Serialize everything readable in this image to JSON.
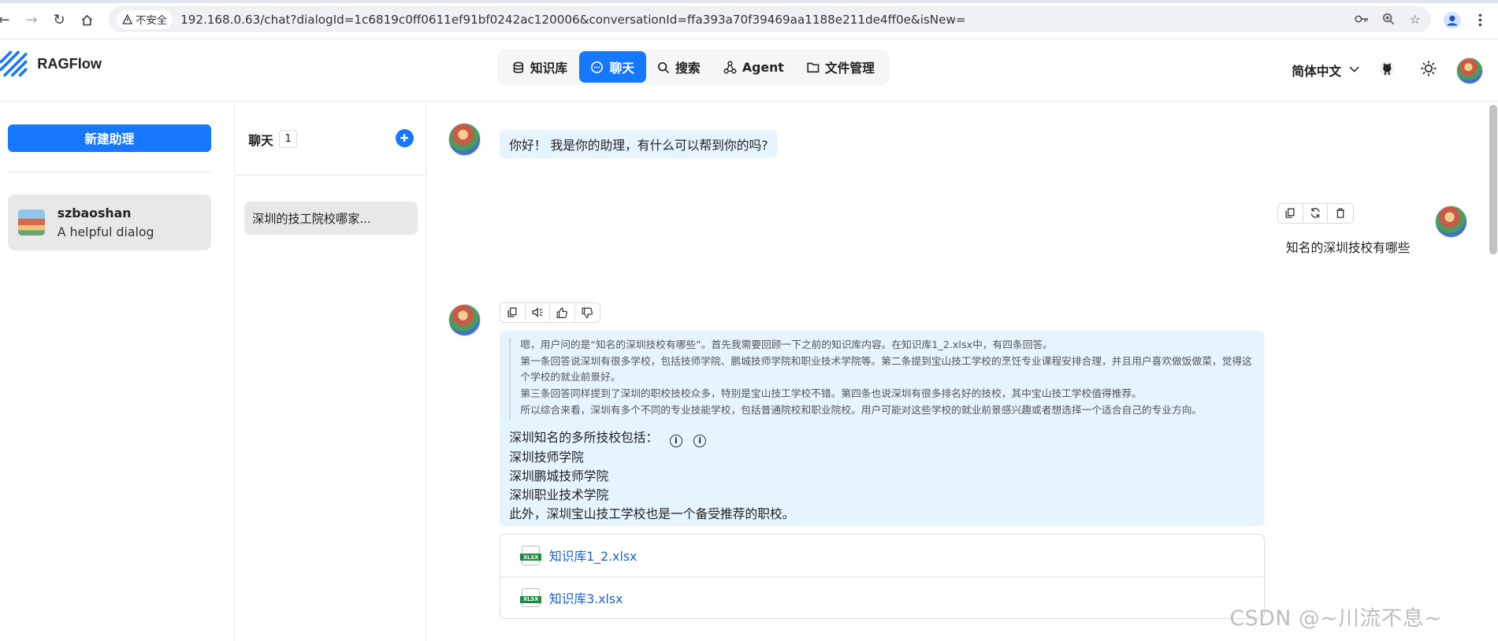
{
  "browser": {
    "security_label": "不安全",
    "url": "192.168.0.63/chat?dialogId=1c6819c0ff0611ef91bf0242ac120006&conversationId=ffa393a70f39469aa1188e211de4ff0e&isNew="
  },
  "app": {
    "name": "RAGFlow",
    "nav": [
      {
        "label": "知识库",
        "icon": "database-icon"
      },
      {
        "label": "聊天",
        "icon": "chat-icon",
        "active": true
      },
      {
        "label": "搜索",
        "icon": "search-icon"
      },
      {
        "label": "Agent",
        "icon": "agent-icon"
      },
      {
        "label": "文件管理",
        "icon": "folder-icon"
      }
    ],
    "language": "简体中文",
    "accent_color": "#1677ff"
  },
  "left_panel": {
    "new_button": "新建助理",
    "assistant": {
      "name": "szbaoshan",
      "description": "A helpful dialog"
    }
  },
  "middle_panel": {
    "title": "聊天",
    "count": "1",
    "conversation": "深圳的技工院校哪家..."
  },
  "chat": {
    "greeting": "你好！ 我是你的助理，有什么可以帮到你的吗?",
    "user_question": "知名的深圳技校有哪些",
    "thinking": [
      "嗯，用户问的是“知名的深圳技校有哪些”。首先我需要回顾一下之前的知识库内容。在知识库1_2.xlsx中，有四条回答。",
      "第一条回答说深圳有很多学校，包括技师学院、鹏城技师学院和职业技术学院等。第二条提到宝山技工学校的烹饪专业课程安排合理，并且用户喜欢做饭做菜，觉得这个学校的就业前景好。",
      "第三条回答同样提到了深圳的职校技校众多，特别是宝山技工学校不错。第四条也说深圳有很多排名好的技校，其中宝山技工学校值得推荐。",
      "所以综合来看，深圳有多个不同的专业技能学校，包括普通院校和职业院校。用户可能对这些学校的就业前景感兴趣或者想选择一个适合自己的专业方向。"
    ],
    "answer_intro": "深圳知名的多所技校包括：",
    "answer_lines": [
      "深圳技师学院",
      "深圳鹏城技师学院",
      "深圳职业技术学院",
      "此外，深圳宝山技工学校也是一个备受推荐的职校。"
    ],
    "files": [
      "知识库1_2.xlsx",
      "知识库3.xlsx"
    ]
  },
  "watermark": "CSDN @~川流不息~"
}
